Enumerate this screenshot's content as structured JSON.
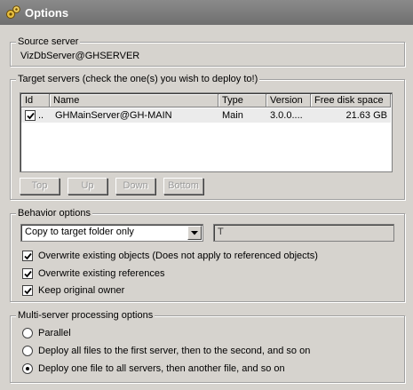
{
  "window": {
    "title": "Options"
  },
  "source_server": {
    "label": "Source server",
    "value": "VizDbServer@GHSERVER"
  },
  "target_servers": {
    "label": "Target servers (check the one(s) you wish to deploy to!)",
    "columns": [
      "Id",
      "Name",
      "Type",
      "Version",
      "Free disk space"
    ],
    "rows": [
      {
        "checked": true,
        "id": "..",
        "name": "GHMainServer@GH-MAIN",
        "type": "Main",
        "version": "3.0.0....",
        "free_disk": "21.63 GB"
      }
    ],
    "buttons": {
      "top": "Top",
      "up": "Up",
      "down": "Down",
      "bottom": "Bottom"
    }
  },
  "behavior": {
    "label": "Behavior options",
    "mode_selected": "Copy to target folder only",
    "path_value": "T",
    "options": [
      {
        "label": "Overwrite existing objects (Does not apply to referenced objects)",
        "checked": true
      },
      {
        "label": "Overwrite existing references",
        "checked": true
      },
      {
        "label": "Keep original owner",
        "checked": true
      }
    ]
  },
  "multi_server": {
    "label": "Multi-server processing options",
    "options": [
      {
        "label": "Parallel",
        "selected": false
      },
      {
        "label": "Deploy all files to the first server, then to the second, and so on",
        "selected": false
      },
      {
        "label": "Deploy one file to all servers, then another file, and so on",
        "selected": true
      }
    ]
  }
}
